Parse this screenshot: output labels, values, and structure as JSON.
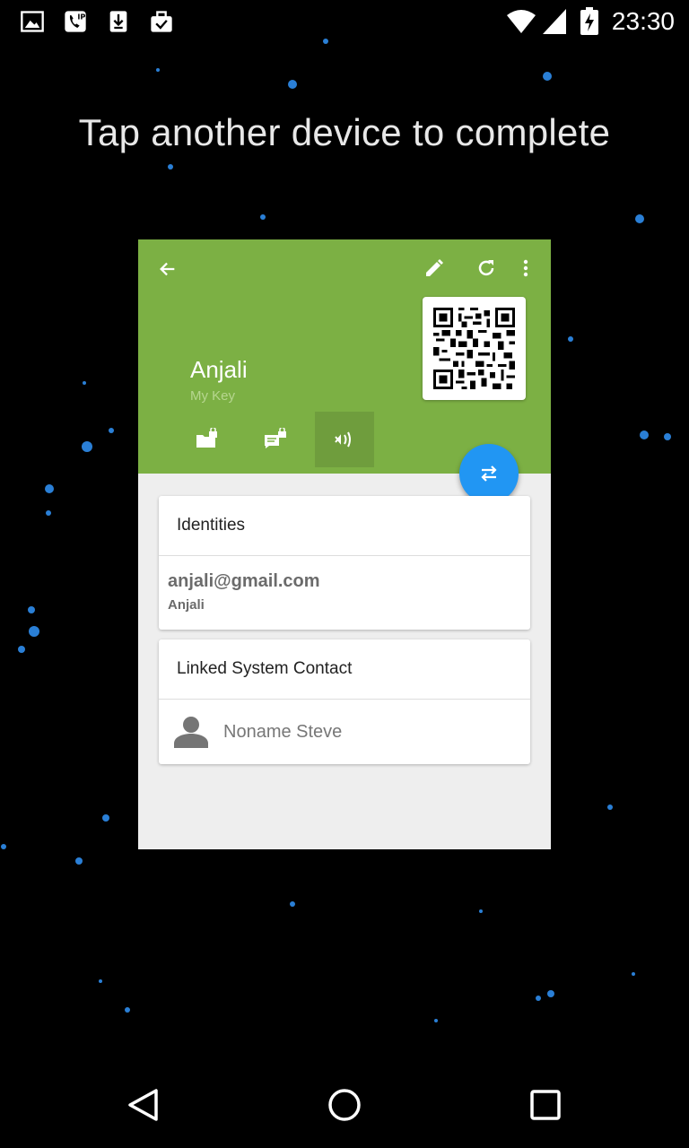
{
  "status_bar": {
    "time": "23:30",
    "notification_icons": [
      "image-icon",
      "voip-phone-icon",
      "download-icon",
      "briefcase-check-icon"
    ],
    "system_icons": [
      "wifi-icon",
      "signal-icon",
      "battery-charging-icon"
    ]
  },
  "prompt": "Tap another device to complete",
  "key_screen": {
    "toolbar": {
      "back_icon": "arrow-back-icon",
      "actions": [
        "edit-icon",
        "refresh-icon",
        "more-vert-icon"
      ]
    },
    "name": "Anjali",
    "subtitle": "My Key",
    "tabs": [
      "encrypt-files-icon",
      "encrypt-text-icon",
      "nfc-icon"
    ],
    "fab_icon": "exchange-icon",
    "identities": {
      "title": "Identities",
      "email": "anjali@gmail.com",
      "email_name": "Anjali"
    },
    "linked_contact": {
      "title": "Linked System Contact",
      "name": "Noname Steve"
    },
    "colors": {
      "header": "#7cb044",
      "fab": "#2196f3"
    }
  },
  "nav_bar": [
    "back-icon",
    "home-icon",
    "recents-icon"
  ]
}
